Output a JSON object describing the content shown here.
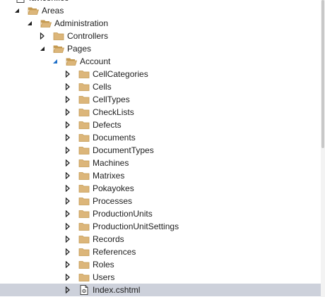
{
  "solution_explorer": {
    "items": [
      {
        "label": "favicon.ico",
        "depth": 0,
        "expander": "none",
        "icon": "file-icon",
        "selected": false
      },
      {
        "label": "Areas",
        "depth": 1,
        "expander": "expanded",
        "icon": "folder-open-icon",
        "selected": false
      },
      {
        "label": "Administration",
        "depth": 2,
        "expander": "expanded",
        "icon": "folder-open-icon",
        "selected": false
      },
      {
        "label": "Controllers",
        "depth": 3,
        "expander": "collapsed",
        "icon": "folder-icon",
        "selected": false
      },
      {
        "label": "Pages",
        "depth": 3,
        "expander": "expanded",
        "icon": "folder-open-icon",
        "selected": false
      },
      {
        "label": "Account",
        "depth": 4,
        "expander": "expanded-active",
        "icon": "folder-open-icon",
        "selected": false
      },
      {
        "label": "CellCategories",
        "depth": 5,
        "expander": "collapsed",
        "icon": "folder-icon",
        "selected": false
      },
      {
        "label": "Cells",
        "depth": 5,
        "expander": "collapsed",
        "icon": "folder-icon",
        "selected": false
      },
      {
        "label": "CellTypes",
        "depth": 5,
        "expander": "collapsed",
        "icon": "folder-icon",
        "selected": false
      },
      {
        "label": "CheckLists",
        "depth": 5,
        "expander": "collapsed",
        "icon": "folder-icon",
        "selected": false
      },
      {
        "label": "Defects",
        "depth": 5,
        "expander": "collapsed",
        "icon": "folder-icon",
        "selected": false
      },
      {
        "label": "Documents",
        "depth": 5,
        "expander": "collapsed",
        "icon": "folder-icon",
        "selected": false
      },
      {
        "label": "DocumentTypes",
        "depth": 5,
        "expander": "collapsed",
        "icon": "folder-icon",
        "selected": false
      },
      {
        "label": "Machines",
        "depth": 5,
        "expander": "collapsed",
        "icon": "folder-icon",
        "selected": false
      },
      {
        "label": "Matrixes",
        "depth": 5,
        "expander": "collapsed",
        "icon": "folder-icon",
        "selected": false
      },
      {
        "label": "Pokayokes",
        "depth": 5,
        "expander": "collapsed",
        "icon": "folder-icon",
        "selected": false
      },
      {
        "label": "Processes",
        "depth": 5,
        "expander": "collapsed",
        "icon": "folder-icon",
        "selected": false
      },
      {
        "label": "ProductionUnits",
        "depth": 5,
        "expander": "collapsed",
        "icon": "folder-icon",
        "selected": false
      },
      {
        "label": "ProductionUnitSettings",
        "depth": 5,
        "expander": "collapsed",
        "icon": "folder-icon",
        "selected": false
      },
      {
        "label": "Records",
        "depth": 5,
        "expander": "collapsed",
        "icon": "folder-icon",
        "selected": false
      },
      {
        "label": "References",
        "depth": 5,
        "expander": "collapsed",
        "icon": "folder-icon",
        "selected": false
      },
      {
        "label": "Roles",
        "depth": 5,
        "expander": "collapsed",
        "icon": "folder-icon",
        "selected": false
      },
      {
        "label": "Users",
        "depth": 5,
        "expander": "collapsed",
        "icon": "folder-icon",
        "selected": false
      },
      {
        "label": "Index.cshtml",
        "depth": 5,
        "expander": "collapsed",
        "icon": "razor-file-icon",
        "selected": true
      }
    ]
  },
  "colors": {
    "folder": "#dcb67a",
    "folder_dark": "#c49a52",
    "expander": "#1e1e1e",
    "expander_active": "#1e6fc8",
    "selected_row": "#cdd1db",
    "text": "#1e1e1e"
  }
}
